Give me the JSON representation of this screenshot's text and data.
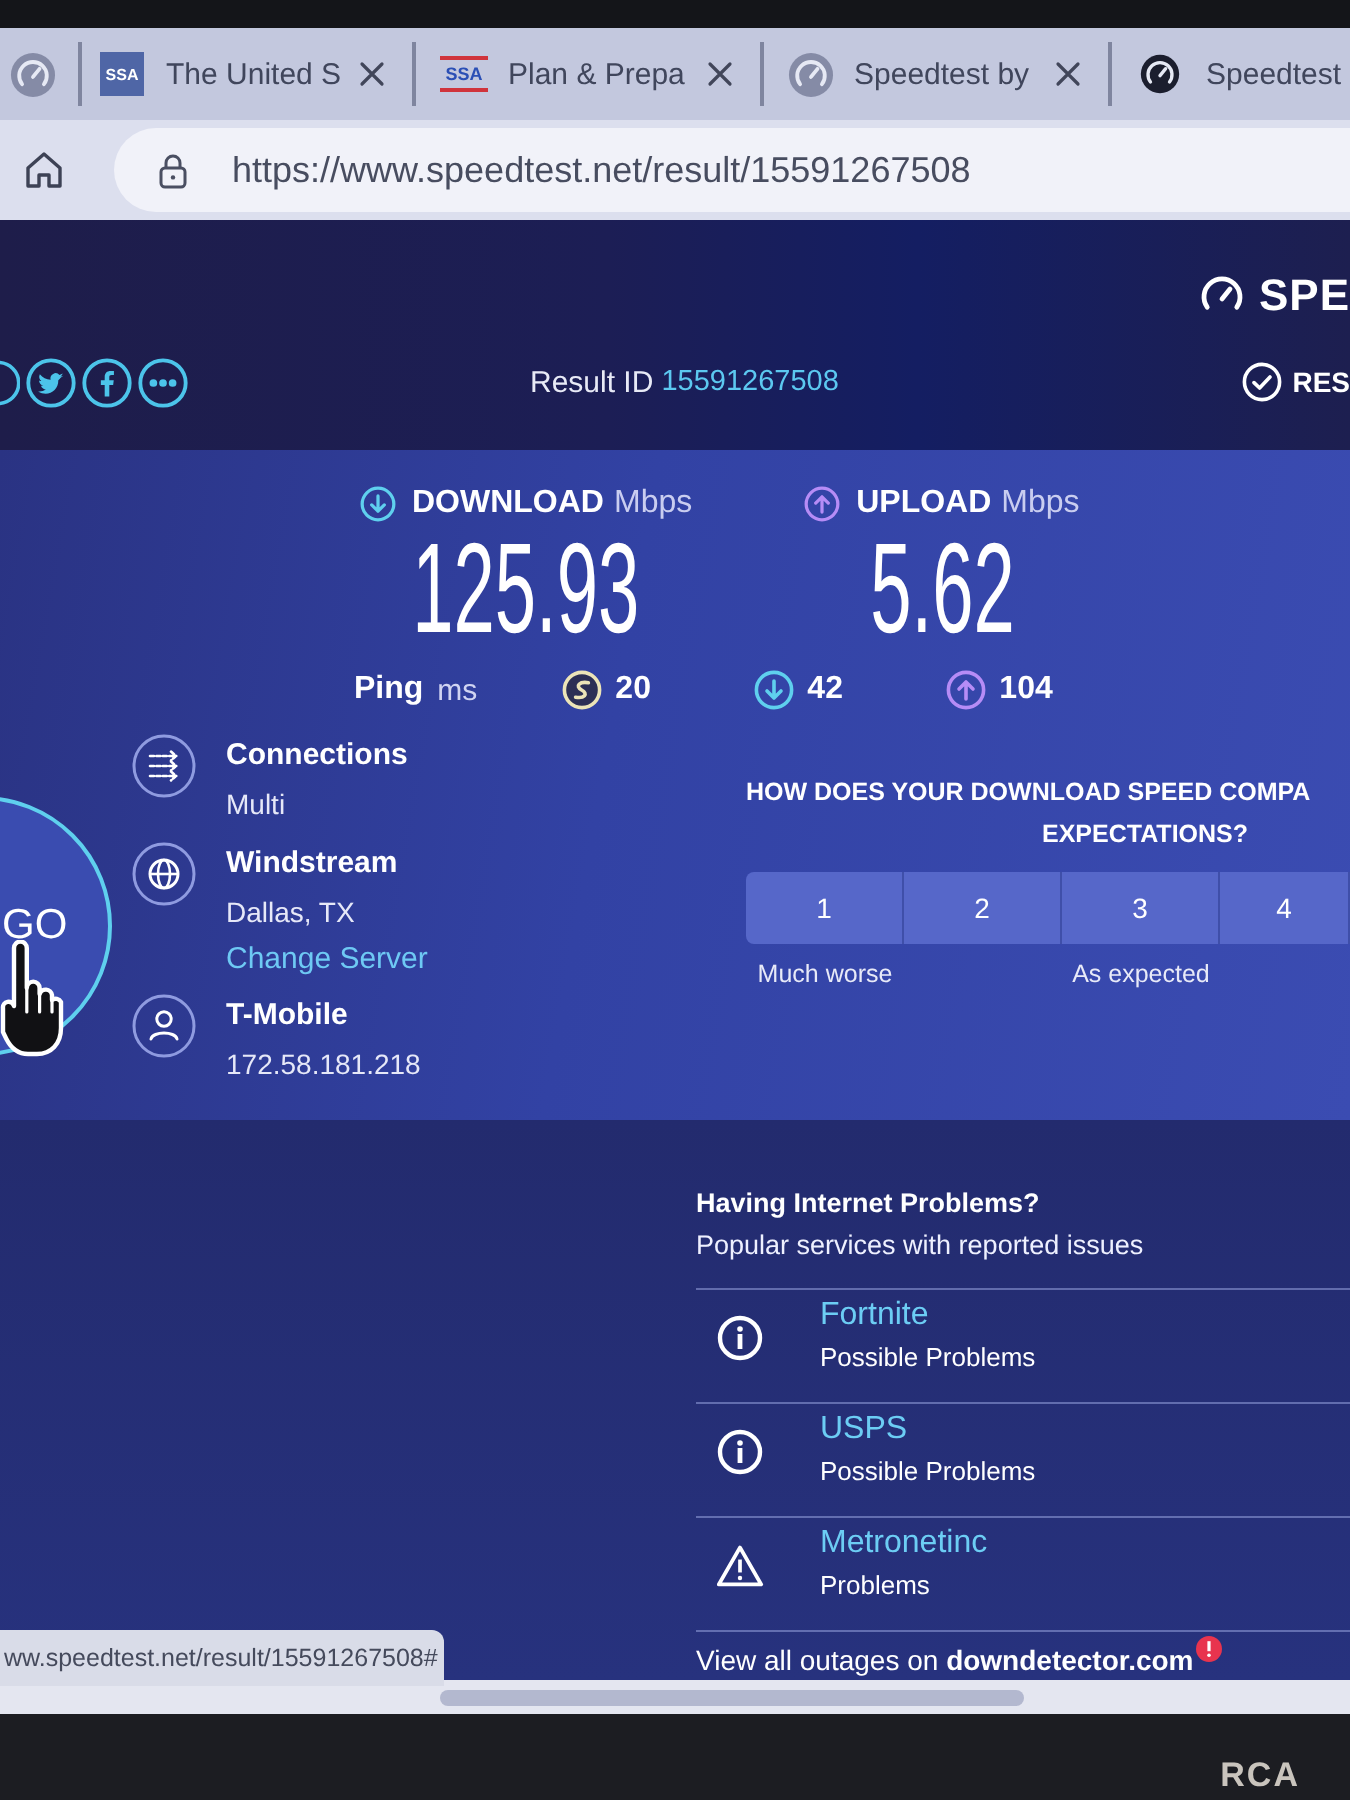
{
  "browser": {
    "tabs": [
      {
        "kind": "gauge",
        "closable": false
      },
      {
        "kind": "tile",
        "icon_text": "SSA",
        "title": "The United S",
        "closable": true
      },
      {
        "kind": "logo",
        "icon_text": "SSA",
        "title": "Plan & Prepa",
        "closable": true
      },
      {
        "kind": "gauge",
        "title": "Speedtest by",
        "closable": true
      },
      {
        "kind": "solid",
        "title": "Speedtest",
        "closable": false
      }
    ],
    "address_bar": {
      "url": "https://www.speedtest.net/result/15591267508"
    }
  },
  "header": {
    "logo_text": "SPE",
    "result_label": "Result ID",
    "result_id": "15591267508",
    "results_link": "RES"
  },
  "results": {
    "metrics": [
      {
        "kind": "download",
        "label": "DOWNLOAD",
        "unit": "Mbps",
        "value": "125.93"
      },
      {
        "kind": "upload",
        "label": "UPLOAD",
        "unit": "Mbps",
        "value": "5.62"
      }
    ],
    "ping": {
      "label": "Ping",
      "unit": "ms",
      "readings": [
        {
          "kind": "idle",
          "value": "20"
        },
        {
          "kind": "download",
          "value": "42"
        },
        {
          "kind": "upload",
          "value": "104"
        }
      ]
    }
  },
  "go_button": {
    "label": "GO"
  },
  "connection_info": [
    {
      "kind": "connections",
      "title": "Connections",
      "value": "Multi"
    },
    {
      "kind": "server",
      "title": "Windstream",
      "value": "Dallas, TX",
      "link": "Change Server"
    },
    {
      "kind": "client",
      "title": "T-Mobile",
      "value": "172.58.181.218"
    }
  ],
  "survey": {
    "question_lines": [
      "HOW DOES YOUR DOWNLOAD SPEED COMPA",
      "EXPECTATIONS?"
    ],
    "ratings": [
      {
        "label": "1",
        "caption": "Much worse",
        "selected": false
      },
      {
        "label": "2",
        "selected": false
      },
      {
        "label": "3",
        "caption": "As expected",
        "selected": false
      },
      {
        "label": "4",
        "selected": false
      }
    ]
  },
  "outages": {
    "title": "Having Internet Problems?",
    "subtitle": "Popular services with reported issues",
    "services": [
      {
        "kind": "info",
        "name": "Fortnite",
        "status": "Possible Problems"
      },
      {
        "kind": "info",
        "name": "USPS",
        "status": "Possible Problems"
      },
      {
        "kind": "warning",
        "name": "Metronetinc",
        "status": "Problems"
      }
    ],
    "footer_text": "View all outages on",
    "footer_link": "downdetector.com"
  },
  "status_bar": {
    "url": "ww.speedtest.net/result/15591267508#"
  },
  "monitor": {
    "brand": "RCA"
  }
}
